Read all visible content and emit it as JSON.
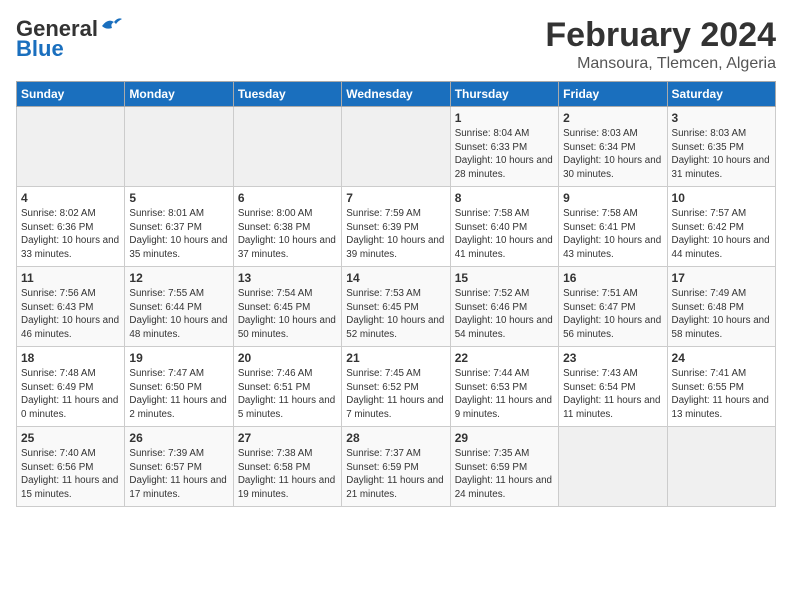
{
  "header": {
    "logo_line1": "General",
    "logo_line2": "Blue",
    "month_year": "February 2024",
    "location": "Mansoura, Tlemcen, Algeria"
  },
  "weekdays": [
    "Sunday",
    "Monday",
    "Tuesday",
    "Wednesday",
    "Thursday",
    "Friday",
    "Saturday"
  ],
  "weeks": [
    [
      {
        "day": "",
        "info": ""
      },
      {
        "day": "",
        "info": ""
      },
      {
        "day": "",
        "info": ""
      },
      {
        "day": "",
        "info": ""
      },
      {
        "day": "1",
        "info": "Sunrise: 8:04 AM\nSunset: 6:33 PM\nDaylight: 10 hours\nand 28 minutes."
      },
      {
        "day": "2",
        "info": "Sunrise: 8:03 AM\nSunset: 6:34 PM\nDaylight: 10 hours\nand 30 minutes."
      },
      {
        "day": "3",
        "info": "Sunrise: 8:03 AM\nSunset: 6:35 PM\nDaylight: 10 hours\nand 31 minutes."
      }
    ],
    [
      {
        "day": "4",
        "info": "Sunrise: 8:02 AM\nSunset: 6:36 PM\nDaylight: 10 hours\nand 33 minutes."
      },
      {
        "day": "5",
        "info": "Sunrise: 8:01 AM\nSunset: 6:37 PM\nDaylight: 10 hours\nand 35 minutes."
      },
      {
        "day": "6",
        "info": "Sunrise: 8:00 AM\nSunset: 6:38 PM\nDaylight: 10 hours\nand 37 minutes."
      },
      {
        "day": "7",
        "info": "Sunrise: 7:59 AM\nSunset: 6:39 PM\nDaylight: 10 hours\nand 39 minutes."
      },
      {
        "day": "8",
        "info": "Sunrise: 7:58 AM\nSunset: 6:40 PM\nDaylight: 10 hours\nand 41 minutes."
      },
      {
        "day": "9",
        "info": "Sunrise: 7:58 AM\nSunset: 6:41 PM\nDaylight: 10 hours\nand 43 minutes."
      },
      {
        "day": "10",
        "info": "Sunrise: 7:57 AM\nSunset: 6:42 PM\nDaylight: 10 hours\nand 44 minutes."
      }
    ],
    [
      {
        "day": "11",
        "info": "Sunrise: 7:56 AM\nSunset: 6:43 PM\nDaylight: 10 hours\nand 46 minutes."
      },
      {
        "day": "12",
        "info": "Sunrise: 7:55 AM\nSunset: 6:44 PM\nDaylight: 10 hours\nand 48 minutes."
      },
      {
        "day": "13",
        "info": "Sunrise: 7:54 AM\nSunset: 6:45 PM\nDaylight: 10 hours\nand 50 minutes."
      },
      {
        "day": "14",
        "info": "Sunrise: 7:53 AM\nSunset: 6:45 PM\nDaylight: 10 hours\nand 52 minutes."
      },
      {
        "day": "15",
        "info": "Sunrise: 7:52 AM\nSunset: 6:46 PM\nDaylight: 10 hours\nand 54 minutes."
      },
      {
        "day": "16",
        "info": "Sunrise: 7:51 AM\nSunset: 6:47 PM\nDaylight: 10 hours\nand 56 minutes."
      },
      {
        "day": "17",
        "info": "Sunrise: 7:49 AM\nSunset: 6:48 PM\nDaylight: 10 hours\nand 58 minutes."
      }
    ],
    [
      {
        "day": "18",
        "info": "Sunrise: 7:48 AM\nSunset: 6:49 PM\nDaylight: 11 hours\nand 0 minutes."
      },
      {
        "day": "19",
        "info": "Sunrise: 7:47 AM\nSunset: 6:50 PM\nDaylight: 11 hours\nand 2 minutes."
      },
      {
        "day": "20",
        "info": "Sunrise: 7:46 AM\nSunset: 6:51 PM\nDaylight: 11 hours\nand 5 minutes."
      },
      {
        "day": "21",
        "info": "Sunrise: 7:45 AM\nSunset: 6:52 PM\nDaylight: 11 hours\nand 7 minutes."
      },
      {
        "day": "22",
        "info": "Sunrise: 7:44 AM\nSunset: 6:53 PM\nDaylight: 11 hours\nand 9 minutes."
      },
      {
        "day": "23",
        "info": "Sunrise: 7:43 AM\nSunset: 6:54 PM\nDaylight: 11 hours\nand 11 minutes."
      },
      {
        "day": "24",
        "info": "Sunrise: 7:41 AM\nSunset: 6:55 PM\nDaylight: 11 hours\nand 13 minutes."
      }
    ],
    [
      {
        "day": "25",
        "info": "Sunrise: 7:40 AM\nSunset: 6:56 PM\nDaylight: 11 hours\nand 15 minutes."
      },
      {
        "day": "26",
        "info": "Sunrise: 7:39 AM\nSunset: 6:57 PM\nDaylight: 11 hours\nand 17 minutes."
      },
      {
        "day": "27",
        "info": "Sunrise: 7:38 AM\nSunset: 6:58 PM\nDaylight: 11 hours\nand 19 minutes."
      },
      {
        "day": "28",
        "info": "Sunrise: 7:37 AM\nSunset: 6:59 PM\nDaylight: 11 hours\nand 21 minutes."
      },
      {
        "day": "29",
        "info": "Sunrise: 7:35 AM\nSunset: 6:59 PM\nDaylight: 11 hours\nand 24 minutes."
      },
      {
        "day": "",
        "info": ""
      },
      {
        "day": "",
        "info": ""
      }
    ]
  ]
}
